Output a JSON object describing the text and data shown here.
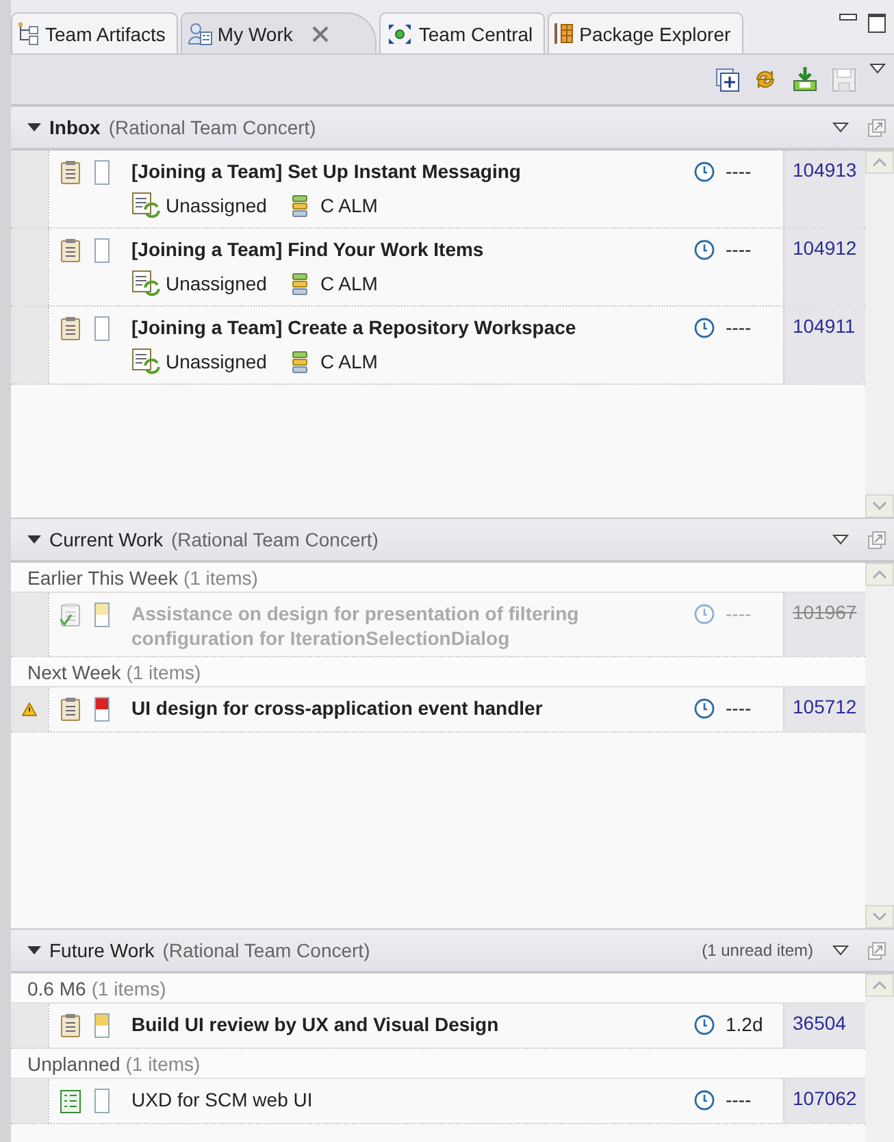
{
  "tabs": [
    {
      "label": "Team Artifacts",
      "selected": false,
      "kind": "artifacts",
      "closable": false
    },
    {
      "label": "My Work",
      "selected": true,
      "kind": "mywork",
      "closable": true
    },
    {
      "label": "Team Central",
      "selected": false,
      "kind": "central",
      "closable": false
    },
    {
      "label": "Package Explorer",
      "selected": false,
      "kind": "package",
      "closable": false
    }
  ],
  "sections": [
    {
      "title": "Inbox",
      "source": "(Rational Team Concert)",
      "bold": true,
      "expanded": true,
      "items": [
        {
          "kind": "task",
          "color": "#ffffff",
          "title": "[Joining a Team] Set Up Instant Messaging",
          "bold": true,
          "resolved": false,
          "warning": false,
          "estimate": "----",
          "id": "104913",
          "owner": "Unassigned",
          "category": "C ALM"
        },
        {
          "kind": "task",
          "color": "#ffffff",
          "title": "[Joining a Team] Find Your Work Items",
          "bold": true,
          "resolved": false,
          "warning": false,
          "estimate": "----",
          "id": "104912",
          "owner": "Unassigned",
          "category": "C ALM"
        },
        {
          "kind": "task",
          "color": "#ffffff",
          "title": "[Joining a Team] Create a Repository Workspace",
          "bold": true,
          "resolved": false,
          "warning": false,
          "estimate": "----",
          "id": "104911",
          "owner": "Unassigned",
          "category": "C ALM"
        }
      ]
    },
    {
      "title": "Current Work",
      "source": "(Rational Team Concert)",
      "bold": false,
      "expanded": true,
      "groups": [
        {
          "label": "Earlier This Week",
          "count": "(1 items)",
          "items": [
            {
              "kind": "task",
              "color": "#f6e6a8",
              "title": "Assistance on design for presentation of filtering configuration for IterationSelectionDialog",
              "bold": true,
              "resolved": true,
              "warning": false,
              "estimate": "----",
              "id": "101967"
            }
          ]
        },
        {
          "label": "Next Week",
          "count": "(1 items)",
          "items": [
            {
              "kind": "task",
              "color": "#dd2222",
              "title": "UI design for cross-application event handler",
              "bold": true,
              "resolved": false,
              "warning": true,
              "estimate": "----",
              "id": "105712"
            }
          ]
        }
      ]
    },
    {
      "title": "Future Work",
      "source": "(Rational Team Concert)",
      "bold": false,
      "expanded": true,
      "note": "(1 unread item)",
      "groups": [
        {
          "label": "0.6 M6",
          "count": "(1 items)",
          "items": [
            {
              "kind": "task",
              "color": "#f2d060",
              "title": "Build UI review by UX and Visual Design",
              "bold": true,
              "resolved": false,
              "warning": false,
              "estimate": "1.2d",
              "id": "36504"
            }
          ]
        },
        {
          "label": "Unplanned",
          "count": "(1 items)",
          "items": [
            {
              "kind": "story",
              "color": "#ffffff",
              "title": "UXD for SCM web UI",
              "bold": false,
              "resolved": false,
              "warning": false,
              "estimate": "----",
              "id": "107062"
            }
          ]
        }
      ]
    }
  ]
}
